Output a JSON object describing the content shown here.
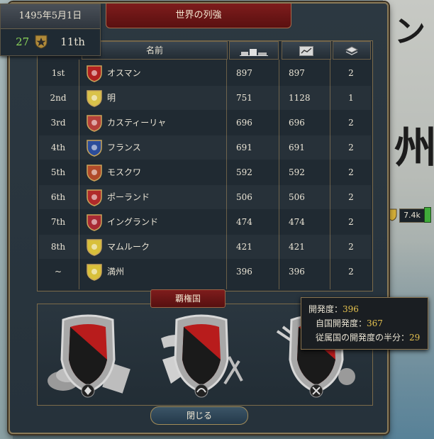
{
  "window": {
    "title": "世界の列強",
    "close_label": "閉じる"
  },
  "date_panel": {
    "date": "1495年5月1日",
    "score": "27",
    "rank": "11th"
  },
  "columns": {
    "name": "名前"
  },
  "rows": [
    {
      "rank": "1st",
      "name": "オスマン",
      "v1": "897",
      "v2": "897",
      "v3": "2",
      "flag": "#b02020",
      "flag_icon": "crescent-icon"
    },
    {
      "rank": "2nd",
      "name": "明",
      "v1": "751",
      "v2": "1128",
      "v3": "1",
      "flag": "#d9c24a",
      "flag_icon": "ming-flag-icon"
    },
    {
      "rank": "3rd",
      "name": "カスティーリャ",
      "v1": "696",
      "v2": "696",
      "v3": "2",
      "flag": "#b5403a",
      "flag_icon": "castile-flag-icon"
    },
    {
      "rank": "4th",
      "name": "フランス",
      "v1": "691",
      "v2": "691",
      "v3": "2",
      "flag": "#2c4d9a",
      "flag_icon": "fleur-de-lis-icon"
    },
    {
      "rank": "5th",
      "name": "モスクワ",
      "v1": "592",
      "v2": "592",
      "v3": "2",
      "flag": "#b04a2a",
      "flag_icon": "muscovy-flag-icon"
    },
    {
      "rank": "6th",
      "name": "ポーランド",
      "v1": "506",
      "v2": "506",
      "v3": "2",
      "flag": "#b02a2a",
      "flag_icon": "white-eagle-icon"
    },
    {
      "rank": "7th",
      "name": "イングランド",
      "v1": "474",
      "v2": "474",
      "v3": "2",
      "flag": "#a82a34",
      "flag_icon": "england-flag-icon"
    },
    {
      "rank": "8th",
      "name": "マムルーク",
      "v1": "421",
      "v2": "421",
      "v3": "2",
      "flag": "#d8c03a",
      "flag_icon": "mamluk-flag-icon"
    },
    {
      "rank": "~",
      "name": "満州",
      "v1": "396",
      "v2": "396",
      "v3": "2",
      "flag": "#d8c03a",
      "flag_icon": "manchu-flag-icon"
    }
  ],
  "hegemon": {
    "title": "覇権国"
  },
  "tooltip": {
    "dev_label": "開発度：",
    "dev_value": "396",
    "own_label": "自国開発度：",
    "own_value": "367",
    "sub_label": "従属国の開発度の半分：",
    "sub_value": "29"
  },
  "map": {
    "army_strength": "7.4k",
    "glyph_top": "ン",
    "glyph_mid": "州"
  }
}
